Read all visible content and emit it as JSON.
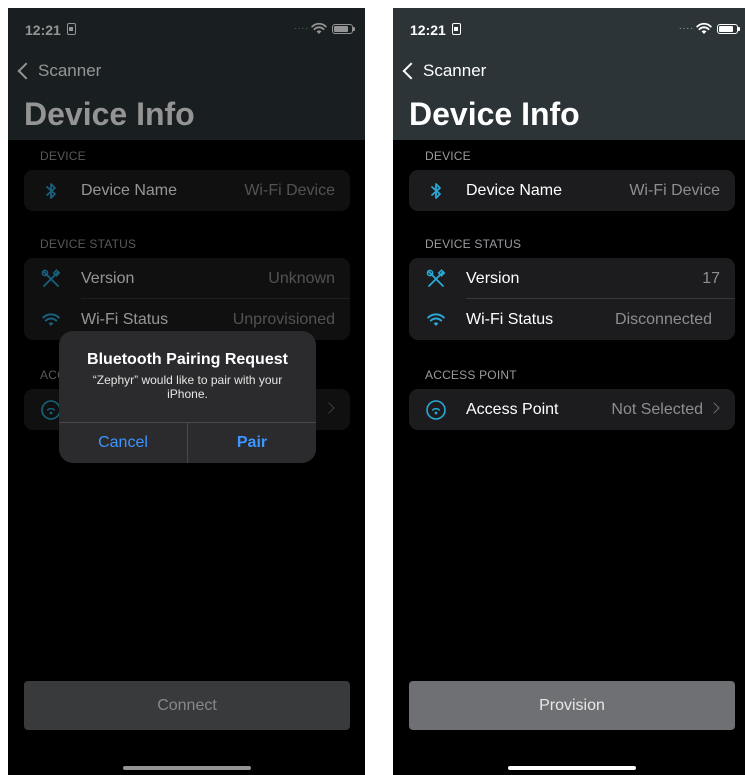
{
  "colors": {
    "accent": "#2aa8d6",
    "alert_button": "#3d95ff",
    "header_bg": "#2c3438",
    "group_bg": "#1c1c1e"
  },
  "left": {
    "status_time": "12:21",
    "nav_back": "Scanner",
    "title": "Device Info",
    "sections": {
      "device": "DEVICE",
      "device_status": "DEVICE STATUS",
      "access_point": "ACC"
    },
    "rows": {
      "device_name": {
        "label": "Device Name",
        "value": "Wi-Fi Device",
        "icon": "bluetooth-icon"
      },
      "version": {
        "label": "Version",
        "value": "Unknown",
        "icon": "tools-icon"
      },
      "wifi_status": {
        "label": "Wi-Fi Status",
        "value": "Unprovisioned",
        "icon": "wifi-icon"
      }
    },
    "button": "Connect",
    "alert": {
      "title": "Bluetooth Pairing Request",
      "message": "“Zephyr” would like to pair with your iPhone.",
      "cancel": "Cancel",
      "confirm": "Pair"
    }
  },
  "right": {
    "status_time": "12:21",
    "nav_back": "Scanner",
    "title": "Device Info",
    "sections": {
      "device": "DEVICE",
      "device_status": "DEVICE STATUS",
      "access_point": "ACCESS POINT"
    },
    "rows": {
      "device_name": {
        "label": "Device Name",
        "value": "Wi-Fi Device",
        "icon": "bluetooth-icon"
      },
      "version": {
        "label": "Version",
        "value": "17",
        "icon": "tools-icon"
      },
      "wifi_status": {
        "label": "Wi-Fi Status",
        "value": "Disconnected",
        "icon": "wifi-icon"
      },
      "access_point": {
        "label": "Access Point",
        "value": "Not Selected",
        "icon": "wifi-circle-icon"
      }
    },
    "button": "Provision"
  }
}
